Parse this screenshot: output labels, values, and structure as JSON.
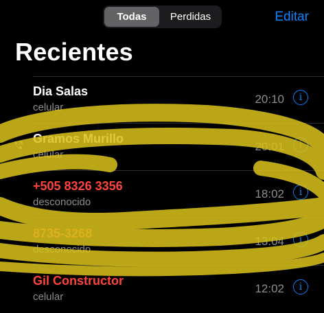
{
  "segments": {
    "all": "Todas",
    "missed": "Perdidas"
  },
  "edit_label": "Editar",
  "title": "Recientes",
  "calls": [
    {
      "name": "Dia Salas",
      "type": "celular",
      "time": "20:10",
      "missed": false
    },
    {
      "name": "Gramos  Murillo",
      "type": "celular",
      "time": "20:01",
      "missed": false,
      "outgoing": true
    },
    {
      "name": "+505 8326 3356",
      "type": "desconocido",
      "time": "18:02",
      "missed": true
    },
    {
      "name": "8735-3268",
      "type": "desconocido",
      "time": "13:04",
      "missed": true
    },
    {
      "name": "Gil Constructor",
      "type": "celular",
      "time": "12:02",
      "missed": true
    }
  ],
  "icons": {
    "info": "info-icon",
    "outgoing": "outgoing-phone-icon"
  },
  "colors": {
    "accent": "#0a84ff",
    "missed": "#ff453a",
    "overlay": "#d9c21a"
  }
}
